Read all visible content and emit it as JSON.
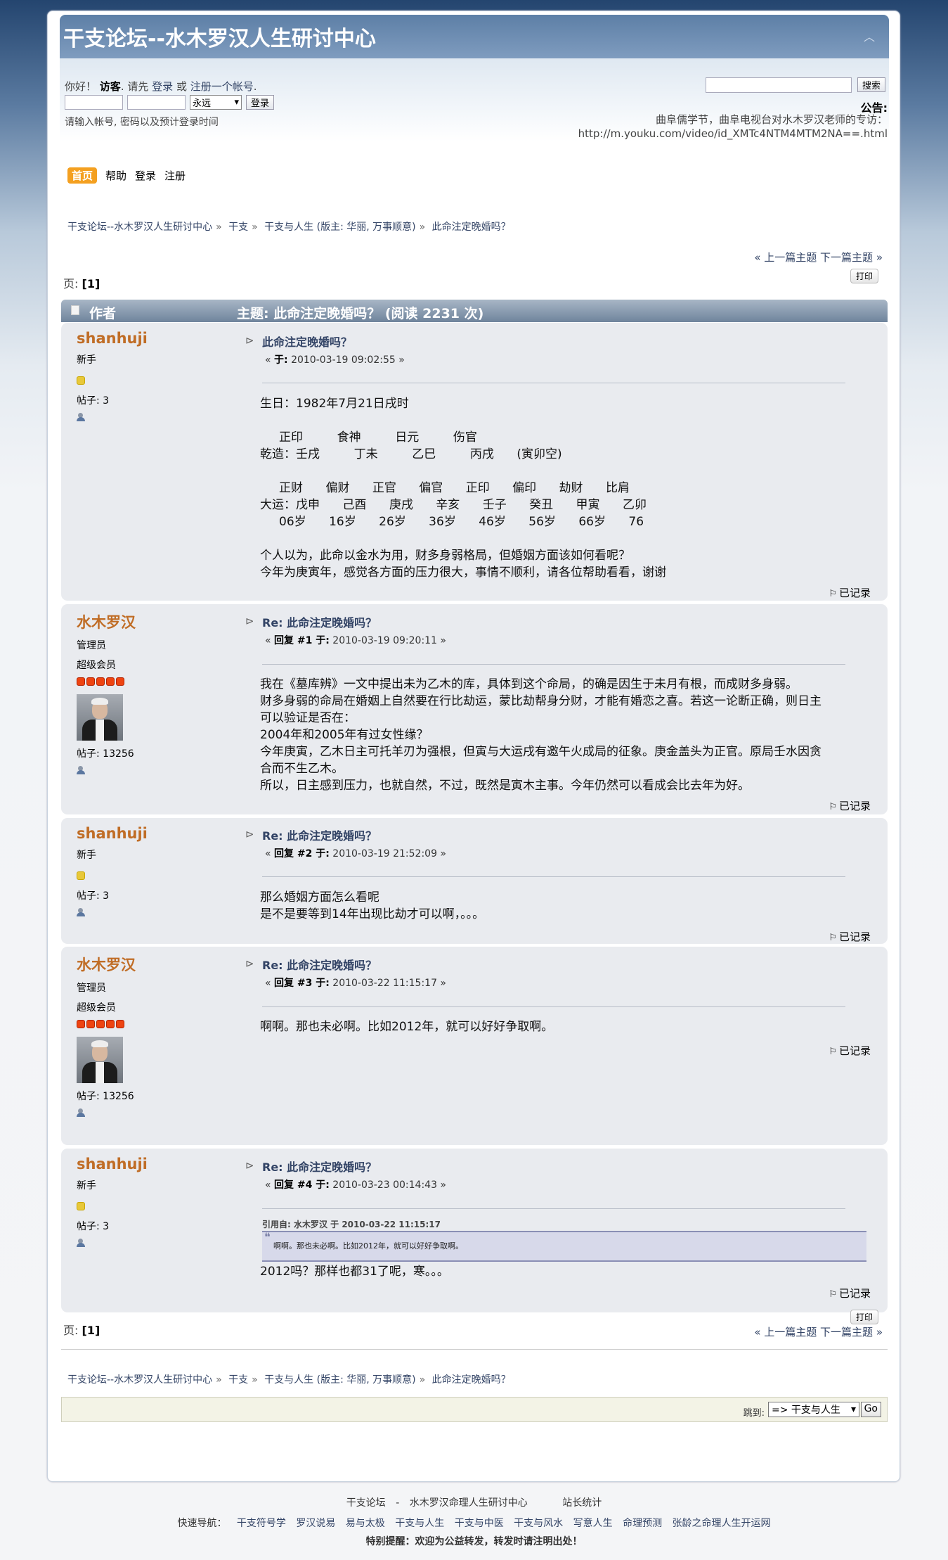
{
  "forum_title": "干支论坛--水木罗汉人生研讨中心",
  "user": {
    "greeting_1": "你好！",
    "guest": "访客",
    "greeting_2": ". 请先",
    "login": "登录",
    "or": "或",
    "register": "注册一个帐号",
    "period": ".",
    "duration": "永远",
    "login_button": "登录",
    "hint": "请输入帐号, 密码以及预计登录时间"
  },
  "search": {
    "button": "搜索"
  },
  "news": {
    "title": "公告:",
    "line1": "曲阜儒学节，曲阜电视台对水木罗汉老师的专访：",
    "line2": "http://m.youku.com/video/id_XMTc4NTM4MTM2NA==.html"
  },
  "menu": {
    "home": "首页",
    "help": "帮助",
    "login": "登录",
    "register": "注册"
  },
  "breadcrumb": {
    "forum": "干支论坛--水木罗汉人生研讨中心",
    "sep": "»",
    "board_category": "干支",
    "board": "干支与人生",
    "moderators": "(版主: 华丽, 万事顺意)",
    "topic": "此命注定晚婚吗？"
  },
  "nav": {
    "prev": "« 上一篇主题",
    "next": "下一篇主题 »",
    "print": "打印"
  },
  "pages": {
    "label": "页:",
    "current": "[1]"
  },
  "table_header": {
    "author": "作者",
    "topic": "主题: 此命注定晚婚吗？ (阅读 2231 次)"
  },
  "posts": [
    {
      "name": "shanhuji",
      "group": "新手",
      "posts": "帖子: 3",
      "title": "此命注定晚婚吗？",
      "meta_pre": "« ",
      "meta_label": "于:",
      "meta_date": " 2010-03-19 09:02:55 »",
      "body": "生日：1982年7月21日戌时\n\n     正印         食神         日元         伤官\n乾造：壬戌         丁未         乙巳         丙戌      (寅卯空)\n\n     正财      偏财      正官      偏官      正印      偏印      劫财      比肩\n大运：戊申      己酉      庚戌      辛亥      壬子      癸丑      甲寅      乙卯\n     06岁      16岁      26岁      36岁      46岁      56岁      66岁      76\n\n个人以为，此命以金水为用，财多身弱格局，但婚姻方面该如何看呢？\n今年为庚寅年，感觉各方面的压力很大，事情不顺利，请各位帮助看看，谢谢",
      "report": "已记录"
    },
    {
      "name": "水木罗汉",
      "group": "管理员",
      "title_rank": "超级会员",
      "posts": "帖子: 13256",
      "title": "Re: 此命注定晚婚吗？",
      "meta_pre": "« ",
      "meta_label": "回复 #1 于:",
      "meta_date": " 2010-03-19 09:20:11 »",
      "body": "我在《墓库辨》一文中提出未为乙木的库，具体到这个命局，的确是因生于未月有根，而成财多身弱。\n财多身弱的命局在婚姻上自然要在行比劫运，蒙比劫帮身分财，才能有婚恋之喜。若这一论断正确，则日主\n可以验证是否在：\n2004年和2005年有过女性缘？\n今年庚寅，乙木日主可托羊刃为强根，但寅与大运戌有邀午火成局的征象。庚金盖头为正官。原局壬水因贪\n合而不生乙木。\n所以，日主感到压力，也就自然，不过，既然是寅木主事。今年仍然可以看成会比去年为好。",
      "report": "已记录"
    },
    {
      "name": "shanhuji",
      "group": "新手",
      "posts": "帖子: 3",
      "title": "Re: 此命注定晚婚吗？",
      "meta_pre": "« ",
      "meta_label": "回复 #2 于:",
      "meta_date": " 2010-03-19 21:52:09 »",
      "body": "那么婚姻方面怎么看呢\n是不是要等到14年出现比劫才可以啊，。。。",
      "report": "已记录"
    },
    {
      "name": "水木罗汉",
      "group": "管理员",
      "title_rank": "超级会员",
      "posts": "帖子: 13256",
      "title": "Re: 此命注定晚婚吗？",
      "meta_pre": "« ",
      "meta_label": "回复 #3 于:",
      "meta_date": " 2010-03-22 11:15:17 »",
      "body": "啊啊。那也未必啊。比如2012年，就可以好好争取啊。",
      "report": "已记录"
    },
    {
      "name": "shanhuji",
      "group": "新手",
      "posts": "帖子: 3",
      "title": "Re: 此命注定晚婚吗？",
      "meta_pre": "« ",
      "meta_label": "回复 #4 于:",
      "meta_date": " 2010-03-23 00:14:43 »",
      "quote_header": "引用自: 水木罗汉 于 2010-03-22 11:15:17",
      "quote_text": "啊啊。那也未必啊。比如2012年，就可以好好争取啊。",
      "body": "2012吗？那样也都31了呢，寒。。。",
      "report": "已记录"
    }
  ],
  "jump": {
    "label": "跳到:",
    "selected": "=> 干支与人生",
    "go": "Go"
  },
  "footer": {
    "line1_a": "干支论坛",
    "line1_sep": "-",
    "line1_b": "水木罗汉命理人生研讨中心",
    "line1_c": "站长统计",
    "nav_label": "快速导航：",
    "links": [
      "干支符号学",
      "罗汉说易",
      "易与太极",
      "干支与人生",
      "干支与中医",
      "干支与风水",
      "写意人生",
      "命理预测",
      "张龄之命理人生开运网"
    ],
    "notice": "特别提醒：欢迎为公益转发，转发时请注明出处！"
  },
  "colors": {
    "accent": "#c06d26",
    "link": "#334466",
    "header_blue": "#5d7fa6",
    "menu_active": "#f4a020",
    "notice_red": "#e01010"
  }
}
